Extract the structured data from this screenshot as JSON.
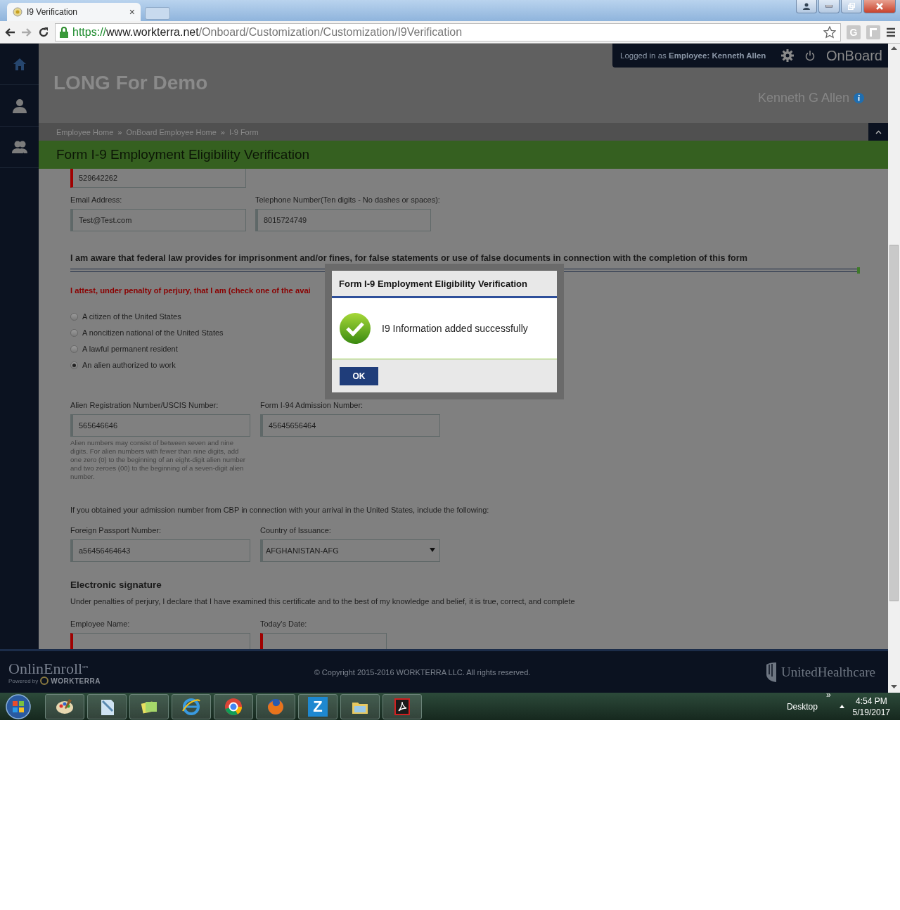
{
  "browser": {
    "tab": {
      "title": "I9 Verification",
      "close": "×"
    },
    "url": {
      "scheme": "https://",
      "host": "www.workterra.net",
      "path": "/Onboard/Customization/Customization/I9Verification"
    },
    "extension_label": "G"
  },
  "header": {
    "logged_in": "Logged in as **Employee:  Kenneth Allen**",
    "app_name": "OnBoard",
    "company": "LONG For Demo",
    "employee_name": "Kenneth G Allen"
  },
  "breadcrumbs": [
    {
      "label": "Employee Home",
      "separator": "»"
    },
    {
      "label": "OnBoard Employee Home",
      "separator": "»"
    },
    {
      "label": "I-9 Form"
    }
  ],
  "page_title": "Form I-9 Employment Eligibility Verification",
  "form": {
    "ssn_field": {
      "value": "529642262",
      "required": true
    },
    "contact_fields": [
      {
        "label": "Email Address:",
        "value": "Test@Test.com",
        "required": false
      },
      {
        "label": "Telephone Number(Ten digits - No dashes or spaces):",
        "value": "8015724749",
        "required": false
      }
    ],
    "statement": "I am aware that federal law provides for imprisonment and/or fines, for false statements or use of false documents in connection with the completion of this form",
    "attestation": "I attest, under penalty of perjury, that I am (check one of the avai",
    "status_options": [
      {
        "label": "A citizen of the United States",
        "selected": false
      },
      {
        "label": "A noncitizen national of the United States",
        "selected": false
      },
      {
        "label": "A lawful permanent resident",
        "selected": false
      },
      {
        "label": "An alien authorized to work",
        "selected": true
      }
    ],
    "alien_fields": [
      {
        "label": "Alien Registration Number/USCIS Number:",
        "value": "565646646",
        "required": false,
        "help": "Alien numbers may consist of between seven and nine digits. For alien numbers with fewer than nine digits, add one zero (0) to the beginning of an eight-digit alien number and two zeroes (00) to the beginning of a seven-digit alien number."
      },
      {
        "label": "Form I-94 Admission Number:",
        "value": "45645656464",
        "required": false
      }
    ],
    "cbp_note": "If you obtained your admission number from CBP in connection with your arrival in the United States, include the following:",
    "passport_fields": [
      {
        "label": "Foreign Passport Number:",
        "value": "a56456464643",
        "kind": "text",
        "required": false
      },
      {
        "label": "Country of Issuance:",
        "value": "AFGHANISTAN-AFG",
        "kind": "select",
        "required": false
      }
    ],
    "signature_heading": "Electronic signature",
    "declaration": "Under penalties of perjury, I declare that I have examined this certificate and to the best of my knowledge and belief, it is true, correct, and complete",
    "signature_fields": [
      {
        "label": "Employee Name:",
        "required": true
      },
      {
        "label": "Today's Date:",
        "required": true
      }
    ]
  },
  "dialog": {
    "title": "Form I-9 Employment Eligibility Verification",
    "message": "I9 Information added successfully",
    "button": "OK"
  },
  "footer": {
    "logo": {
      "name": "OnlinEnroll",
      "mark": "sm",
      "powered_by": "Powered by",
      "partner": "WORKTERRA"
    },
    "copyright": "© Copyright 2015-2016 WORKTERRA LLC. All rights reserved.",
    "partner_logo": "UnitedHealthcare"
  },
  "taskbar": {
    "app_label": "Z",
    "desktop": "Desktop",
    "overflow": "»",
    "time": "4:54 PM",
    "date": "5/19/2017"
  }
}
